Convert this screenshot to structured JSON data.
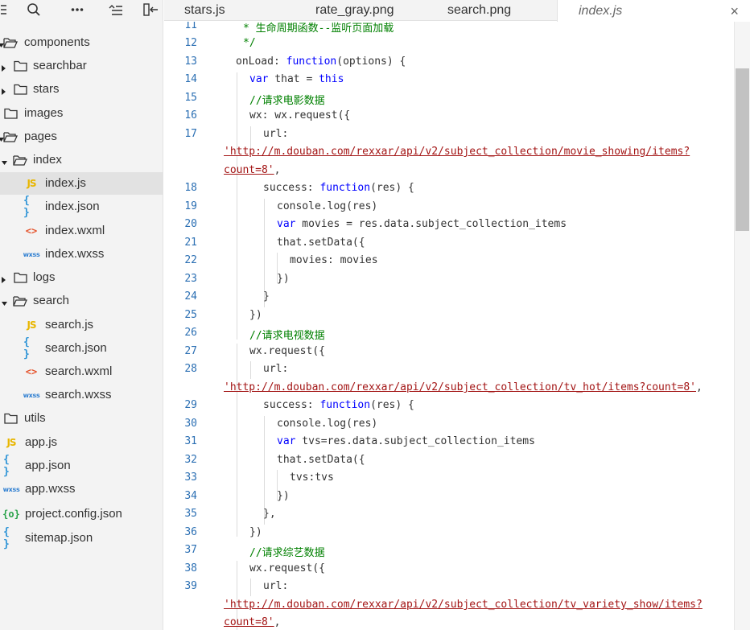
{
  "sidebar": {
    "toolbar": [
      {
        "name": "collapse-menu-icon"
      },
      {
        "name": "search-icon"
      },
      {
        "name": "more-icon"
      },
      {
        "name": "outline-icon"
      },
      {
        "name": "split-panel-icon"
      }
    ],
    "tree": [
      {
        "label": "components",
        "icon": "folder-open-icon",
        "expanded": true,
        "level": 0
      },
      {
        "label": "searchbar",
        "icon": "folder-icon",
        "expanded": false,
        "level": 1
      },
      {
        "label": "stars",
        "icon": "folder-icon",
        "expanded": false,
        "level": 1
      },
      {
        "label": "images",
        "icon": "folder-icon",
        "level": 0
      },
      {
        "label": "pages",
        "icon": "folder-open-icon",
        "expanded": true,
        "level": 0
      },
      {
        "label": "index",
        "icon": "folder-open-icon",
        "expanded": true,
        "level": 1
      },
      {
        "label": "index.js",
        "icon": "js-file-icon",
        "icon_text": "JS",
        "level": 2,
        "selected": true
      },
      {
        "label": "index.json",
        "icon": "json-file-icon",
        "icon_text": "{ }",
        "level": 2
      },
      {
        "label": "index.wxml",
        "icon": "wxml-file-icon",
        "icon_text": "<>",
        "level": 2
      },
      {
        "label": "index.wxss",
        "icon": "wxss-file-icon",
        "icon_text": "wxss",
        "level": 2
      },
      {
        "label": "logs",
        "icon": "folder-icon",
        "expanded": false,
        "level": 1
      },
      {
        "label": "search",
        "icon": "folder-open-icon",
        "expanded": true,
        "level": 1
      },
      {
        "label": "search.js",
        "icon": "js-file-icon",
        "icon_text": "JS",
        "level": 2
      },
      {
        "label": "search.json",
        "icon": "json-file-icon",
        "icon_text": "{ }",
        "level": 2
      },
      {
        "label": "search.wxml",
        "icon": "wxml-file-icon",
        "icon_text": "<>",
        "level": 2
      },
      {
        "label": "search.wxss",
        "icon": "wxss-file-icon",
        "icon_text": "wxss",
        "level": 2
      },
      {
        "label": "utils",
        "icon": "folder-icon",
        "level": 0
      },
      {
        "label": "app.js",
        "icon": "js-file-icon",
        "icon_text": "JS",
        "level": 0
      },
      {
        "label": "app.json",
        "icon": "json-file-icon",
        "icon_text": "{ }",
        "level": 0
      },
      {
        "label": "app.wxss",
        "icon": "wxss-file-icon",
        "icon_text": "wxss",
        "level": 0
      },
      {
        "label": "project.config.json",
        "icon": "config-file-icon",
        "icon_text": "{o}",
        "level": 0
      },
      {
        "label": "sitemap.json",
        "icon": "json-file-icon",
        "icon_text": "{ }",
        "level": 0
      }
    ]
  },
  "tabs": [
    {
      "label": "stars.js"
    },
    {
      "label": "rate_gray.png"
    },
    {
      "label": "search.png"
    },
    {
      "label": "index.js",
      "active": true,
      "close": "×"
    }
  ],
  "editor": {
    "line_numbers": [
      "11",
      "12",
      "13",
      "14",
      "15",
      "16",
      "17",
      "18",
      "19",
      "20",
      "21",
      "22",
      "23",
      "24",
      "25",
      "26",
      "27",
      "28",
      "29",
      "30",
      "31",
      "32",
      "33",
      "34",
      "35",
      "36",
      "37",
      "38",
      "39"
    ],
    "code": {
      "l11": "* 生命周期函数--监听页面加载",
      "l12": "*/",
      "l13_a": "onLoad: ",
      "l13_b": "function",
      "l13_c": "(options) {",
      "l14_a": "var",
      "l14_b": " that = ",
      "l14_c": "this",
      "l15": "//请求电影数据",
      "l16": "wx: wx.request({",
      "l17": "url:",
      "url1": "'http://m.douban.com/rexxar/api/v2/subject_collection/movie_showing/items?",
      "url1_b": "count=8'",
      "url1_c": ",",
      "l18_a": "success: ",
      "l18_b": "function",
      "l18_c": "(res) {",
      "l19": "console.log(res)",
      "l20_a": "var",
      "l20_b": " movies = res.data.subject_collection_items",
      "l21": "that.setData({",
      "l22": "movies: movies",
      "l23": "})",
      "l24": "}",
      "l25": "})",
      "l26": "//请求电视数据",
      "l27": "wx.request({",
      "l28": "url:",
      "url2": "'http://m.douban.com/rexxar/api/v2/subject_collection/tv_hot/items?count=8'",
      "url2_c": ",",
      "l29_a": "success: ",
      "l29_b": "function",
      "l29_c": "(res) {",
      "l30": "console.log(res)",
      "l31_a": "var",
      "l31_b": " tvs=res.data.subject_collection_items",
      "l32": "that.setData({",
      "l33": "tvs:tvs",
      "l34": "})",
      "l35": "},",
      "l36": "})",
      "l37": "//请求综艺数据",
      "l38": "wx.request({",
      "l39": "url:",
      "url3": "'http://m.douban.com/rexxar/api/v2/subject_collection/tv_variety_show/items?",
      "url3_b": "count=8'",
      "url3_c": ","
    }
  },
  "colors": {
    "keyword": "#0000ff",
    "comment": "#008000",
    "string": "#a31515",
    "line_number": "#2b6fb3",
    "js_icon": "#e8b600",
    "json_icon": "#2c93d6",
    "wxml_icon": "#e5532b",
    "config_icon": "#2aa34a"
  }
}
